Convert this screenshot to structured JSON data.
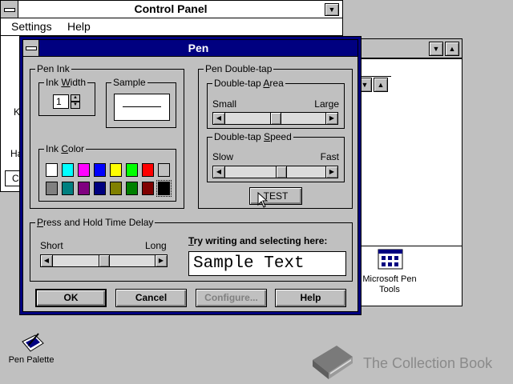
{
  "control_panel": {
    "title": "Control Panel",
    "menu": [
      "Settings",
      "Help"
    ],
    "partial_text_k": "K",
    "partial_text_ha": "Ha",
    "partial_text_c": "C"
  },
  "background_window": {
    "icon_label_line1": "Microsoft Pen",
    "icon_label_line2": "Tools"
  },
  "pen_dialog": {
    "title": "Pen",
    "pen_ink": {
      "label": "Pen Ink",
      "ink_width": {
        "label_pre": "Ink ",
        "label_u": "W",
        "label_post": "idth",
        "value": "1"
      },
      "sample_label": "Sample",
      "ink_color": {
        "label_pre": "Ink ",
        "label_u": "C",
        "label_post": "olor",
        "swatches": [
          "#ffffff",
          "#00ffff",
          "#ff00ff",
          "#0000ff",
          "#ffff00",
          "#00ff00",
          "#ff0000",
          "#c0c0c0",
          "#808080",
          "#008080",
          "#800080",
          "#000080",
          "#808000",
          "#008000",
          "#800000",
          "#000000"
        ],
        "selected_index": 15
      }
    },
    "double_tap": {
      "label": "Pen Double-tap",
      "area": {
        "label_pre": "Double-tap ",
        "label_u": "A",
        "label_post": "rea",
        "min_label": "Small",
        "max_label": "Large",
        "value_fraction": 0.5
      },
      "speed": {
        "label_pre": "Double-tap ",
        "label_u": "S",
        "label_post": "peed",
        "min_label": "Slow",
        "max_label": "Fast",
        "value_fraction": 0.57
      },
      "test_button": "TEST"
    },
    "press_hold": {
      "label_u": "P",
      "label_post": "ress and Hold Time Delay",
      "min_label": "Short",
      "max_label": "Long",
      "value_fraction": 0.5
    },
    "try_writing": {
      "label_u": "T",
      "label_post": "ry writing and selecting here:",
      "value": "Sample Text"
    },
    "buttons": {
      "ok": "OK",
      "cancel": "Cancel",
      "configure": "Configure...",
      "help": "Help"
    }
  },
  "desktop": {
    "pen_palette_label": "Pen Palette",
    "watermark": "The Collection Book"
  }
}
